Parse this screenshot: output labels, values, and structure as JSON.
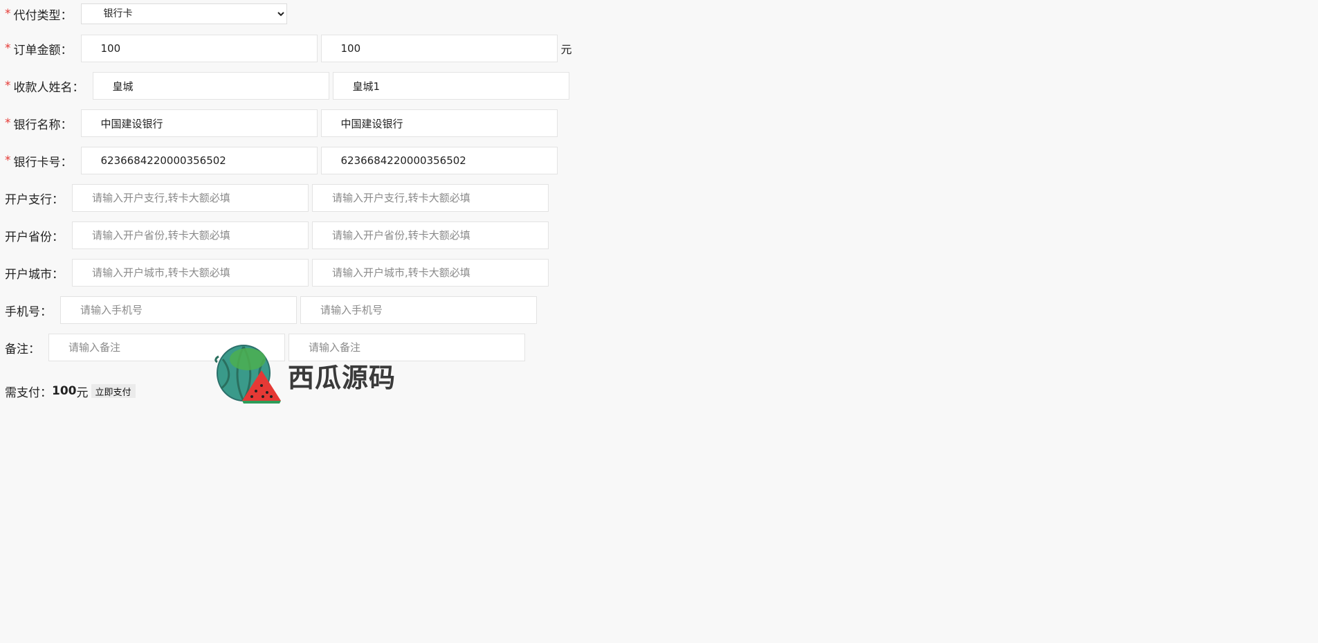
{
  "form": {
    "type_row": {
      "label": "代付类型：",
      "selected": "银行卡"
    },
    "amount_row": {
      "label": "订单金额：",
      "value1": "100",
      "value2": "100",
      "unit": "元"
    },
    "payee_row": {
      "label": "收款人姓名：",
      "value1": "皇城",
      "value2": "皇城1"
    },
    "bank_row": {
      "label": "银行名称：",
      "value1": "中国建设银行",
      "value2": "中国建设银行"
    },
    "card_row": {
      "label": "银行卡号：",
      "value1": "6236684220000356502",
      "value2": "6236684220000356502"
    },
    "branch_row": {
      "label": "开户支行：",
      "placeholder": "请输入开户支行,转卡大额必填"
    },
    "province_row": {
      "label": "开户省份：",
      "placeholder": "请输入开户省份,转卡大额必填"
    },
    "city_row": {
      "label": "开户城市：",
      "placeholder": "请输入开户城市,转卡大额必填"
    },
    "phone_row": {
      "label": "手机号：",
      "placeholder": "请输入手机号"
    },
    "note_row": {
      "label": "备注：",
      "placeholder": "请输入备注"
    },
    "required_mark": "*"
  },
  "payment": {
    "label": "需支付：",
    "amount": "100",
    "unit": "元",
    "button_label": "立即支付"
  },
  "watermark": {
    "text": "西瓜源码",
    "icon": "watermelon-icon"
  },
  "colors": {
    "background": "#f8f8f8",
    "required": "#e53935"
  }
}
